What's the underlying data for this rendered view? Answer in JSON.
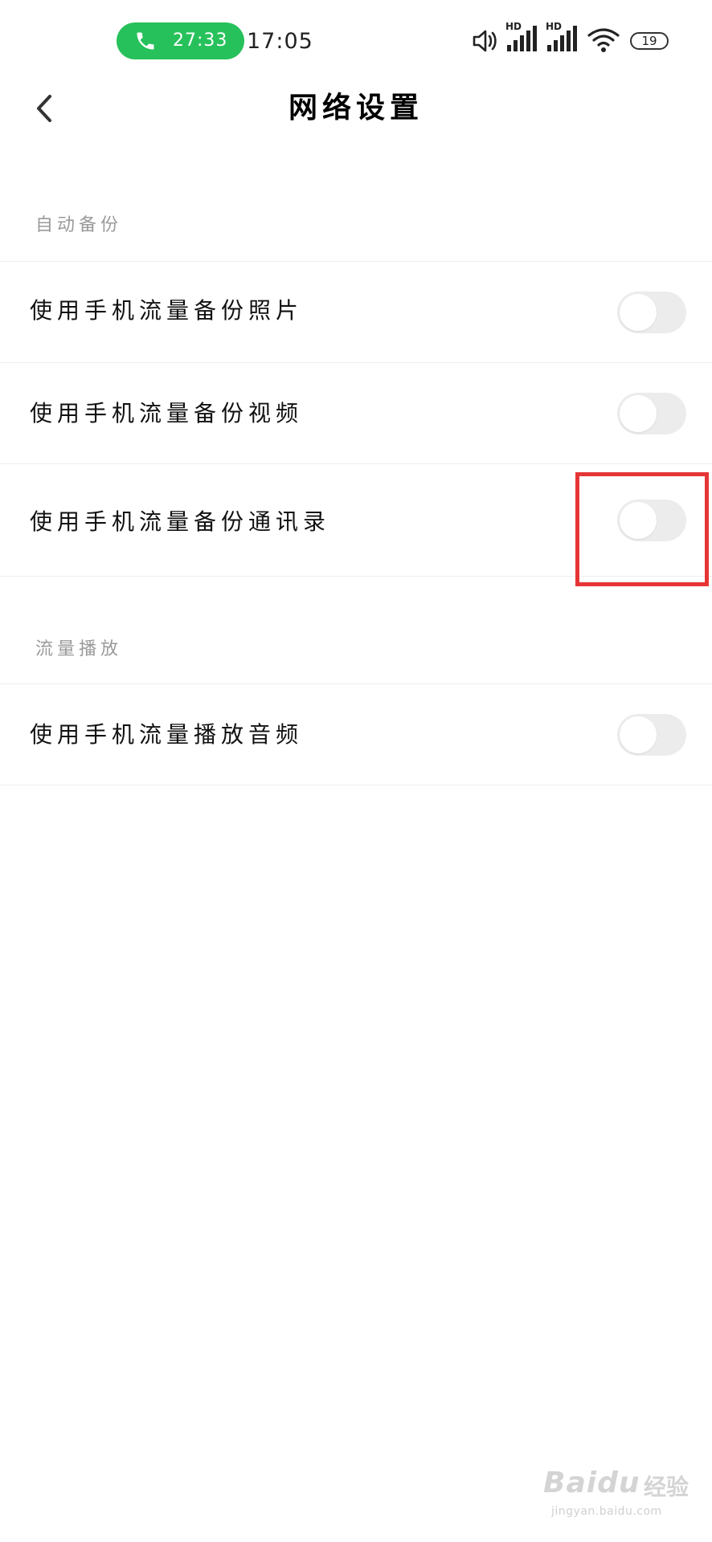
{
  "status_bar": {
    "call_time": "27:33",
    "clock": "17:05",
    "signal1_label": "HD",
    "signal2_label": "HD",
    "battery": "19",
    "call_color": "#27c15b",
    "icons": [
      "phone-icon",
      "speaker-icon",
      "signal-icon",
      "signal-icon",
      "wifi-icon",
      "battery-icon"
    ]
  },
  "header": {
    "title": "网络设置",
    "back_icon": "chevron-left-icon"
  },
  "sections": [
    {
      "title": "自动备份",
      "items": [
        {
          "label": "使用手机流量备份照片",
          "enabled": false
        },
        {
          "label": "使用手机流量备份视频",
          "enabled": false
        },
        {
          "label": "使用手机流量备份通讯录",
          "enabled": false
        }
      ]
    },
    {
      "title": "流量播放",
      "items": [
        {
          "label": "使用手机流量播放音频",
          "enabled": false
        }
      ]
    }
  ],
  "annotation": {
    "highlight_color": "#e63535"
  },
  "watermark": {
    "logo": "Baidu",
    "brand": "经验",
    "url": "jingyan.baidu.com"
  }
}
